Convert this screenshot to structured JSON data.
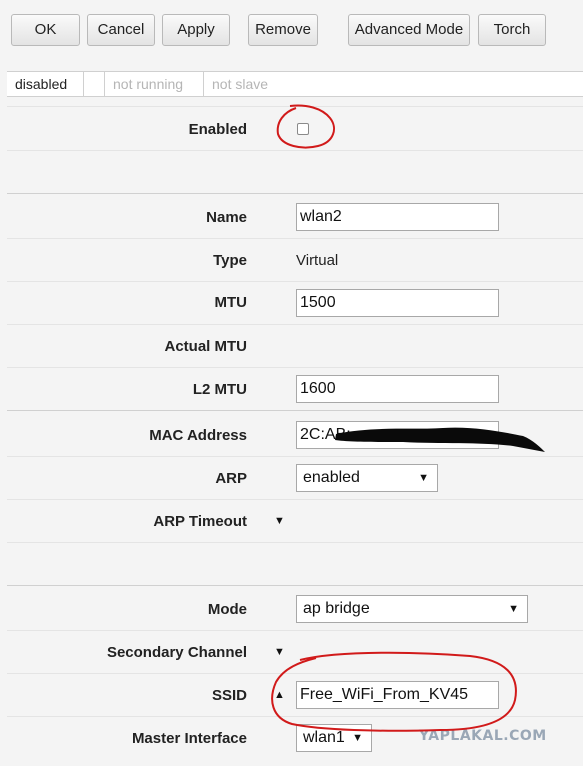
{
  "toolbar": {
    "ok": "OK",
    "cancel": "Cancel",
    "apply": "Apply",
    "remove": "Remove",
    "advanced_mode": "Advanced Mode",
    "torch": "Torch"
  },
  "status": {
    "state": "disabled",
    "running": "not running",
    "slave": "not slave"
  },
  "form": {
    "enabled": {
      "label": "Enabled",
      "checked": false
    },
    "name": {
      "label": "Name",
      "value": "wlan2"
    },
    "type": {
      "label": "Type",
      "value": "Virtual"
    },
    "mtu": {
      "label": "MTU",
      "value": "1500"
    },
    "actual_mtu": {
      "label": "Actual MTU",
      "value": ""
    },
    "l2_mtu": {
      "label": "L2 MTU",
      "value": "1600"
    },
    "mac_address": {
      "label": "MAC Address",
      "value": "2C:AB:"
    },
    "arp": {
      "label": "ARP",
      "value": "enabled"
    },
    "arp_timeout": {
      "label": "ARP Timeout"
    },
    "mode": {
      "label": "Mode",
      "value": "ap bridge"
    },
    "secondary_channel": {
      "label": "Secondary Channel"
    },
    "ssid": {
      "label": "SSID",
      "value": "Free_WiFi_From_KV45"
    },
    "master_interface": {
      "label": "Master Interface",
      "value": "wlan1"
    }
  },
  "icons": {
    "dropdown": "caret-down-icon",
    "expand": "triangle-down-icon",
    "collapse": "triangle-up-icon"
  },
  "watermark": "YAPLAKAL.COM",
  "colors": {
    "annotation": "#d11a1a",
    "background": "#f4f4f4"
  }
}
